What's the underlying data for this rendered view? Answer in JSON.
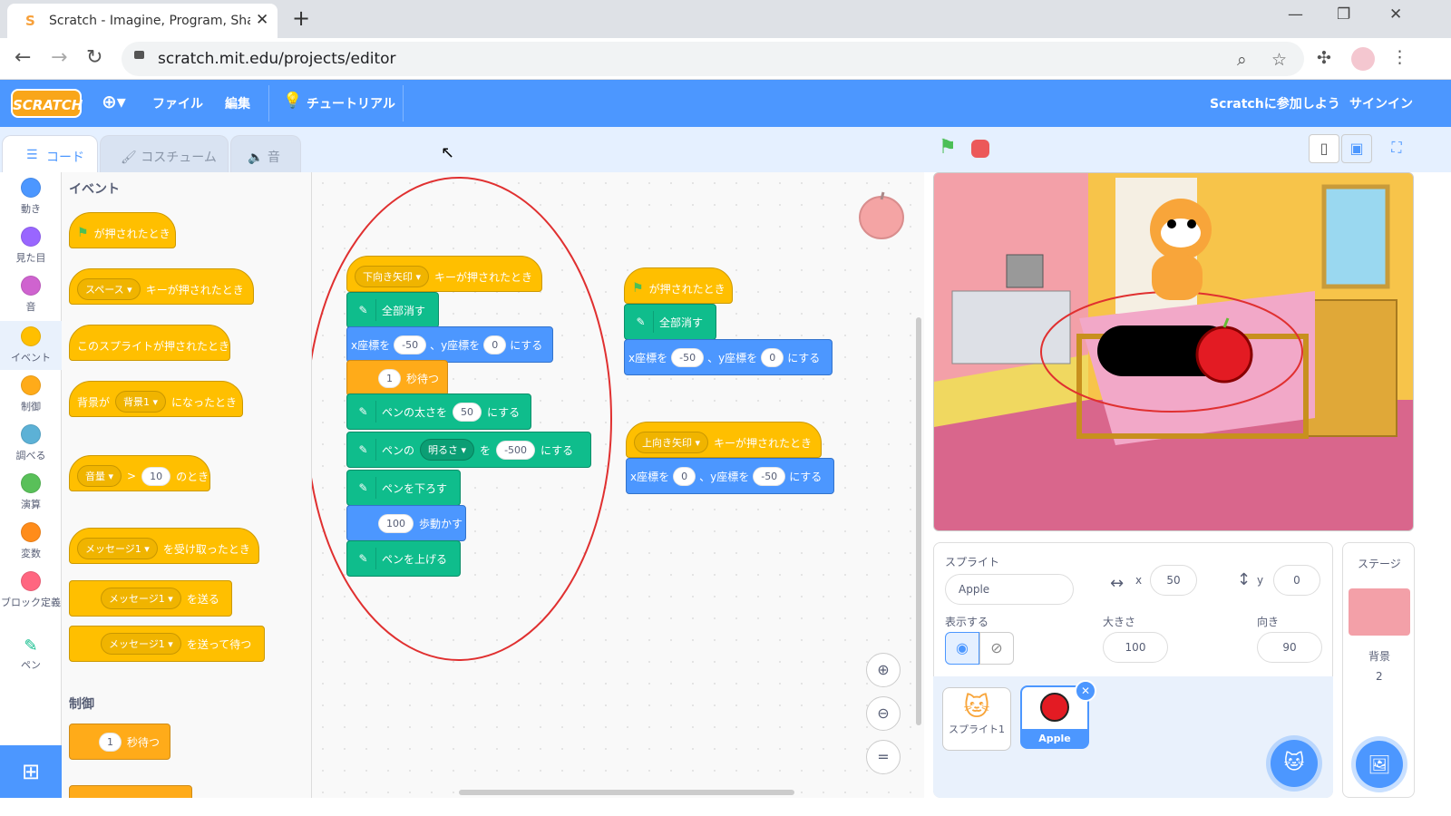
{
  "browser": {
    "tab_title": "Scratch - Imagine, Program, Share",
    "favicon": "S",
    "close": "✕",
    "new_tab": "+",
    "url": "scratch.mit.edu/projects/editor",
    "win": {
      "min": "—",
      "max": "❐",
      "close": "✕"
    }
  },
  "menubar": {
    "logo": "SCRATCH",
    "file": "ファイル",
    "edit": "編集",
    "tutorials": "チュートリアル",
    "join": "Scratchに参加しよう",
    "signin": "サインイン"
  },
  "editor_tabs": {
    "code": "コード",
    "costumes": "コスチューム",
    "sounds": "音"
  },
  "categories": [
    {
      "label": "動き",
      "color": "#4c97ff"
    },
    {
      "label": "見た目",
      "color": "#9966ff"
    },
    {
      "label": "音",
      "color": "#cf63cf"
    },
    {
      "label": "イベント",
      "color": "#ffbf00"
    },
    {
      "label": "制御",
      "color": "#ffab19"
    },
    {
      "label": "調べる",
      "color": "#5cb1d6"
    },
    {
      "label": "演算",
      "color": "#59c059"
    },
    {
      "label": "変数",
      "color": "#ff8c1a"
    },
    {
      "label": "ブロック定義",
      "color": "#ff6680"
    },
    {
      "label": "ペン",
      "color": "#0fbd8c"
    }
  ],
  "palette": {
    "events_heading": "イベント",
    "when_flag": "が押されたとき",
    "key_dd": "スペース",
    "key_pressed": "キーが押されたとき",
    "sprite_clicked": "このスプライトが押されたとき",
    "backdrop_prefix": "背景が",
    "backdrop_dd": "背景1",
    "backdrop_suffix": "になったとき",
    "loudness_dd": "音量",
    "gt": ">",
    "loudness_val": "10",
    "loudness_suffix": "のとき",
    "msg_dd": "メッセージ1",
    "receive": "を受け取ったとき",
    "broadcast": "を送る",
    "broadcast_wait": "を送って待つ",
    "control_heading": "制御",
    "wait_val": "1",
    "wait": "秒待つ"
  },
  "script1": {
    "hat_dd": "下向き矢印",
    "hat_text": "キーが押されたとき",
    "clear": "全部消す",
    "goto_x_label": "x座標を",
    "goto_x": "-50",
    "goto_y_label": "、y座標を",
    "goto_y": "0",
    "goto_suffix": "にする",
    "wait_val": "1",
    "wait": "秒待つ",
    "size_label": "ペンの太さを",
    "size_val": "50",
    "size_suffix": "にする",
    "param_label": "ペンの",
    "param_dd": "明るさ",
    "param_to": "を",
    "param_val": "-500",
    "param_suffix": "にする",
    "pendown": "ペンを下ろす",
    "move_val": "100",
    "move": "歩動かす",
    "penup": "ペンを上げる"
  },
  "script2": {
    "hat": "が押されたとき",
    "clear": "全部消す",
    "goto_x_label": "x座標を",
    "goto_x": "-50",
    "goto_y_label": "、y座標を",
    "goto_y": "0",
    "goto_suffix": "にする"
  },
  "script3": {
    "hat_dd": "上向き矢印",
    "hat_text": "キーが押されたとき",
    "goto_x_label": "x座標を",
    "goto_x": "0",
    "goto_y_label": "、y座標を",
    "goto_y": "-50",
    "goto_suffix": "にする"
  },
  "sprite_info": {
    "sprite_label": "スプライト",
    "name": "Apple",
    "x_label": "x",
    "x": "50",
    "y_label": "y",
    "y": "0",
    "show_label": "表示する",
    "size_label": "大きさ",
    "size": "100",
    "direction_label": "向き",
    "direction": "90"
  },
  "sprites": [
    {
      "name": "スプライト1"
    },
    {
      "name": "Apple"
    }
  ],
  "stage_pane": {
    "title": "ステージ",
    "backdrops_label": "背景",
    "backdrops_count": "2"
  },
  "colors": {
    "scratch_blue": "#4c97ff",
    "events": "#ffbf00",
    "pen": "#0fbd8c",
    "motion": "#4c97ff",
    "control": "#ffab19",
    "annotation": "#e03030"
  }
}
